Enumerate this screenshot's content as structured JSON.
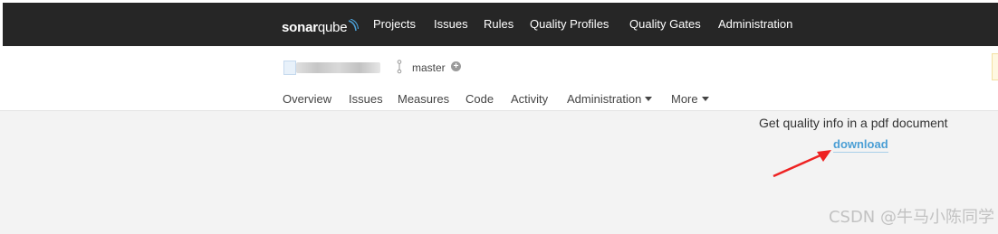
{
  "brand": {
    "name_bold": "sonar",
    "name_light": "qube"
  },
  "main_nav": {
    "items": [
      {
        "label": "Projects"
      },
      {
        "label": "Issues"
      },
      {
        "label": "Rules"
      },
      {
        "label": "Quality Profiles"
      },
      {
        "label": "Quality Gates"
      },
      {
        "label": "Administration"
      }
    ]
  },
  "project": {
    "branch": "master"
  },
  "project_nav": {
    "items": [
      {
        "label": "Overview"
      },
      {
        "label": "Issues"
      },
      {
        "label": "Measures"
      },
      {
        "label": "Code"
      },
      {
        "label": "Activity"
      },
      {
        "label": "Administration"
      },
      {
        "label": "More"
      }
    ]
  },
  "content": {
    "info_text": "Get quality info in a pdf document",
    "download_label": "download"
  },
  "watermark": "CSDN @牛马小陈同学",
  "colors": {
    "topbar_bg": "#262626",
    "content_bg": "#f3f3f3",
    "link": "#4b9fd5",
    "annotation_arrow": "#ee2222"
  }
}
